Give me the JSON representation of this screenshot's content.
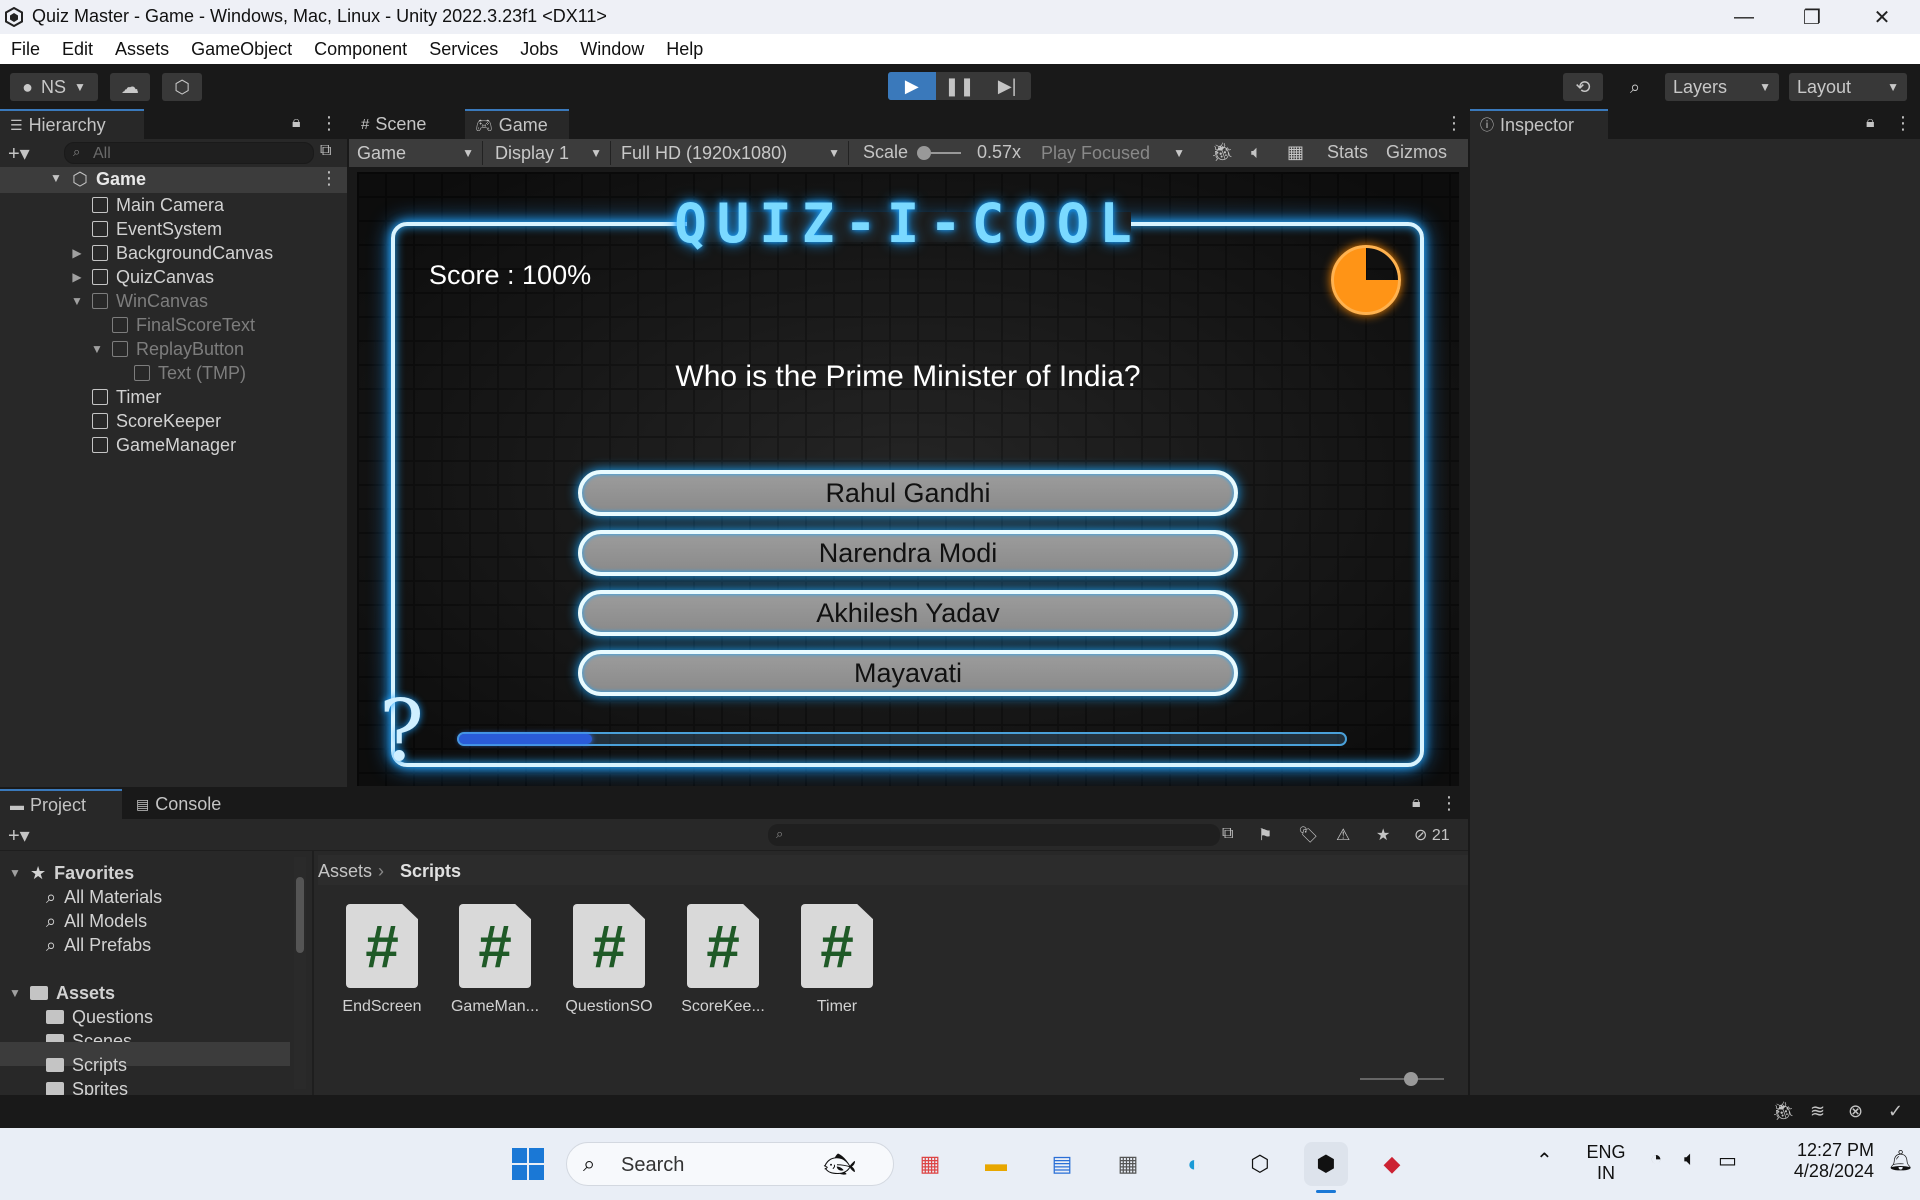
{
  "window": {
    "title": "Quiz Master - Game - Windows, Mac, Linux - Unity 2022.3.23f1 <DX11>"
  },
  "menu": [
    "File",
    "Edit",
    "Assets",
    "GameObject",
    "Component",
    "Services",
    "Jobs",
    "Window",
    "Help"
  ],
  "toolbar": {
    "account": "NS",
    "layers": "Layers",
    "layout": "Layout"
  },
  "hierarchy": {
    "tab": "Hierarchy",
    "search_placeholder": "All",
    "scene": "Game",
    "items": [
      "Main Camera",
      "EventSystem",
      "BackgroundCanvas",
      "QuizCanvas",
      "WinCanvas",
      "FinalScoreText",
      "ReplayButton",
      "Text (TMP)",
      "Timer",
      "ScoreKeeper",
      "GameManager"
    ]
  },
  "views": {
    "scene_tab": "Scene",
    "game_tab": "Game",
    "game_mode": "Game",
    "display": "Display 1",
    "resolution": "Full HD (1920x1080)",
    "scale_label": "Scale",
    "scale_value": "0.57x",
    "play_focused": "Play Focused",
    "stats": "Stats",
    "gizmos": "Gizmos"
  },
  "inspector": {
    "tab": "Inspector"
  },
  "game": {
    "title": "QUIZ-I-COOL",
    "score": "Score : 100%",
    "question": "Who is the Prime Minister of India?",
    "answers": [
      "Rahul Gandhi",
      "Narendra Modi",
      "Akhilesh Yadav",
      "Mayavati"
    ],
    "timer_remaining_fraction": 0.75,
    "progress_fraction": 0.15,
    "question_mark": "?"
  },
  "project": {
    "tab_project": "Project",
    "tab_console": "Console",
    "hidden_count": "21",
    "favorites_label": "Favorites",
    "favorites": [
      "All Materials",
      "All Models",
      "All Prefabs"
    ],
    "assets_label": "Assets",
    "folders": [
      "Questions",
      "Scenes",
      "Scripts",
      "Sprites"
    ],
    "breadcrumb_root": "Assets",
    "breadcrumb_current": "Scripts",
    "scripts": [
      "EndScreen",
      "GameMan...",
      "QuestionSO",
      "ScoreKee...",
      "Timer"
    ]
  },
  "taskbar": {
    "search": "Search",
    "lang_top": "ENG",
    "lang_bottom": "IN",
    "time": "12:27 PM",
    "date": "4/28/2024"
  },
  "colors": {
    "accent": "#3a79bb",
    "neon": "#1aa0ff",
    "timer": "#ff9416",
    "script_hash": "#1f5a27"
  }
}
